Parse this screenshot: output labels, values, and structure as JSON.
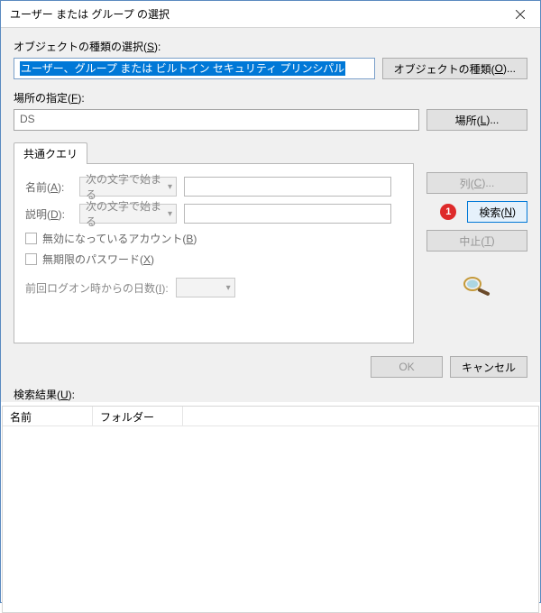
{
  "titlebar": {
    "title": "ユーザー または グループ の選択"
  },
  "object_section": {
    "label": "オブジェクトの種類の選択(S):",
    "value": "ユーザー、グループ または ビルトイン セキュリティ プリンシパル",
    "button": "オブジェクトの種類(O)..."
  },
  "location_section": {
    "label": "場所の指定(F):",
    "value": "DS",
    "button": "場所(L)..."
  },
  "query": {
    "tab": "共通クエリ",
    "name_label": "名前(A):",
    "desc_label": "説明(D):",
    "combo_text": "次の文字で始まる",
    "chk_disabled_accounts": "無効になっているアカウント(B)",
    "chk_no_expire_pw": "無期限のパスワード(X)",
    "days_label": "前回ログオン時からの日数(I):"
  },
  "side": {
    "columns": "列(C)...",
    "search": "検索(N)",
    "stop": "中止(T)"
  },
  "callout": "1",
  "dlg": {
    "ok": "OK",
    "cancel": "キャンセル"
  },
  "results": {
    "label": "検索結果(U):",
    "col_name": "名前",
    "col_folder": "フォルダー"
  }
}
